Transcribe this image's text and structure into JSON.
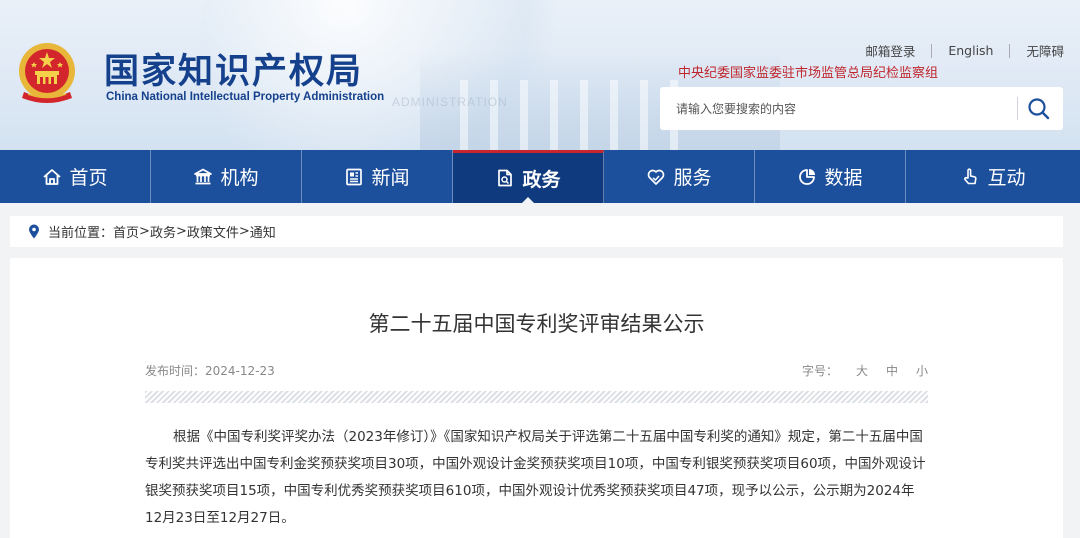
{
  "header": {
    "logo_cn": "国家知识产权局",
    "logo_en": "China National Intellectual Property Administration",
    "watermark": "ADMINISTRATION",
    "top_links": [
      "邮箱登录",
      "English",
      "无障碍"
    ],
    "discipline": "中央纪委国家监委驻市场监管总局纪检监察组",
    "search": {
      "placeholder": "请输入您要搜索的内容",
      "icon": "search-icon"
    }
  },
  "nav": {
    "items": [
      {
        "label": "首页",
        "icon": "home-icon"
      },
      {
        "label": "机构",
        "icon": "institution-icon"
      },
      {
        "label": "新闻",
        "icon": "news-icon"
      },
      {
        "label": "政务",
        "icon": "document-icon",
        "active": true
      },
      {
        "label": "服务",
        "icon": "service-heart-icon"
      },
      {
        "label": "数据",
        "icon": "pie-chart-icon"
      },
      {
        "label": "互动",
        "icon": "hand-pointer-icon"
      }
    ]
  },
  "breadcrumb": {
    "prefix": "当前位置：",
    "items": [
      "首页",
      "政务",
      "政策文件",
      "通知"
    ],
    "separator": ">"
  },
  "article": {
    "title": "第二十五届中国专利奖评审结果公示",
    "date_label": "发布时间：",
    "date": "2024-12-23",
    "font_size_label": "字号：",
    "font_sizes": [
      "大",
      "中",
      "小"
    ],
    "paragraph": "根据《中国专利奖评奖办法（2023年修订）》《国家知识产权局关于评选第二十五届中国专利奖的通知》规定，第二十五届中国专利奖共评选出中国专利金奖预获奖项目30项，中国外观设计金奖预获奖项目10项，中国专利银奖预获奖项目60项，中国外观设计银奖预获奖项目15项，中国专利优秀奖预获奖项目610项，中国外观设计优秀奖预获奖项目47项，现予以公示，公示期为2024年12月23日至12月27日。"
  },
  "colors": {
    "brand_blue": "#14408c",
    "nav_blue": "#1c4f9c",
    "nav_active": "#0f3a7e",
    "accent_red": "#c0262d"
  }
}
